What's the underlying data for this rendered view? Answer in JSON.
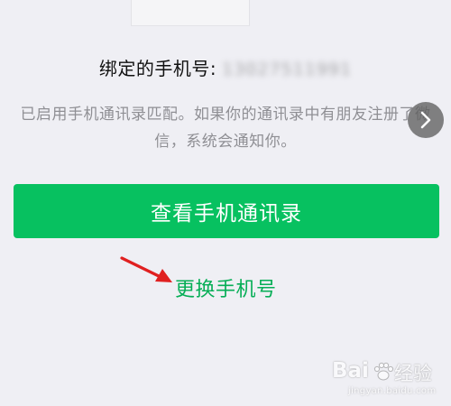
{
  "bound_phone": {
    "label": "绑定的手机号:",
    "number": "13027511991"
  },
  "description": {
    "line1": "已启用手机通讯录匹配。如果你的通讯录中有朋友注册了微",
    "line2": "信，系统会通知你。"
  },
  "buttons": {
    "view_contacts": "查看手机通讯录",
    "change_phone": "更换手机号"
  },
  "watermark": {
    "logo_text": "Bai",
    "logo_suffix": "经验",
    "url": "jingyan.baidu.com"
  },
  "colors": {
    "background": "#efeff4",
    "primary_green": "#07c160",
    "link_green": "#06ae56",
    "annotation_arrow": "#e02020"
  },
  "icons": {
    "next": "chevron-right-icon",
    "annotation": "red-arrow-icon",
    "watermark_paw": "baidu-paw-icon"
  }
}
